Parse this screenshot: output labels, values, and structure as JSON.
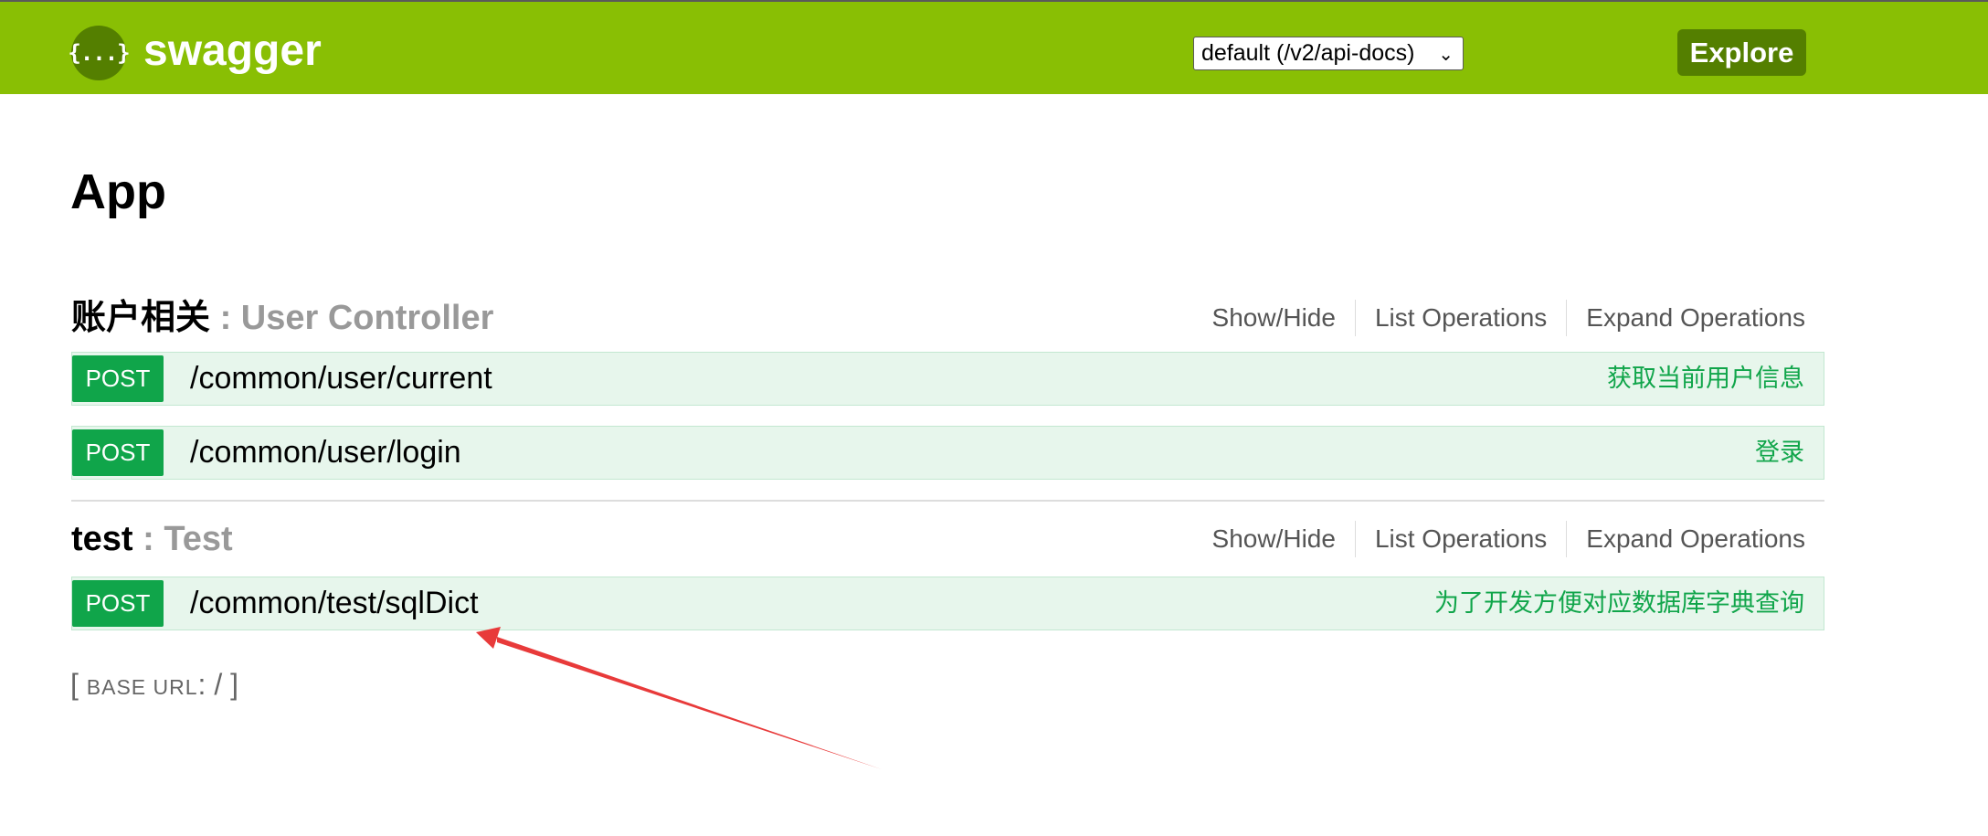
{
  "header": {
    "logo_icon": "{...}",
    "logo_text": "swagger",
    "api_select_value": "default (/v2/api-docs)",
    "explore_label": "Explore",
    "accent_color": "#89bf04"
  },
  "page": {
    "title": "App"
  },
  "resources": [
    {
      "name": "账户相关",
      "description": ": User Controller",
      "actions": [
        "Show/Hide",
        "List Operations",
        "Expand Operations"
      ],
      "operations": [
        {
          "method": "POST",
          "path": "/common/user/current",
          "summary": "获取当前用户信息"
        },
        {
          "method": "POST",
          "path": "/common/user/login",
          "summary": "登录"
        }
      ]
    },
    {
      "name": "test",
      "description": ": Test",
      "actions": [
        "Show/Hide",
        "List Operations",
        "Expand Operations"
      ],
      "operations": [
        {
          "method": "POST",
          "path": "/common/test/sqlDict",
          "summary": "为了开发方便对应数据库字典查询"
        }
      ]
    }
  ],
  "footer": {
    "open_bracket": "[",
    "base_url_label": "BASE URL",
    "base_url_value": ": /",
    "close_bracket": "]"
  },
  "annotation": {
    "arrow_color": "#e83a3a",
    "arrow_icon": "annotation-arrow"
  }
}
